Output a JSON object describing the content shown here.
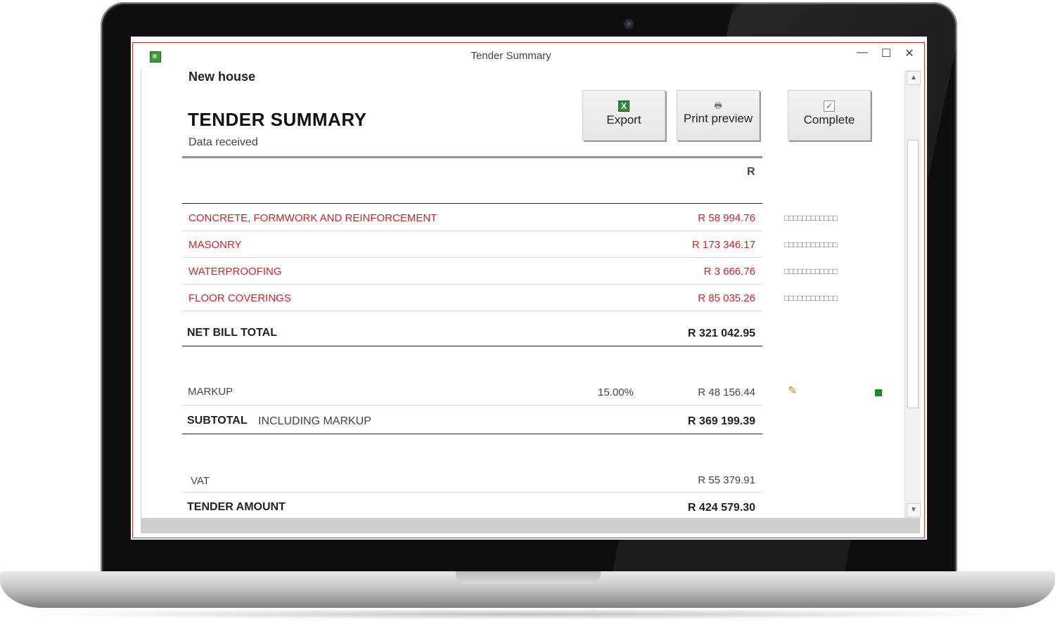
{
  "window": {
    "title": "Tender Summary",
    "minimize": "—",
    "maximize": "☐",
    "close": "✕"
  },
  "header": {
    "project": "New house",
    "heading": "TENDER SUMMARY",
    "status": "Data received"
  },
  "toolbar": {
    "export_label": "Export",
    "print_label": "Print preview",
    "complete_label": "Complete"
  },
  "table": {
    "currency_header": "R",
    "bills": [
      {
        "name": "CONCRETE, FORMWORK AND REINFORCEMENT",
        "amount": "R 58 994.76",
        "progress": "□□□□□□□□□□□□"
      },
      {
        "name": "MASONRY",
        "amount": "R 173 346.17",
        "progress": "□□□□□□□□□□□□"
      },
      {
        "name": "WATERPROOFING",
        "amount": "R 3 666.76",
        "progress": "□□□□□□□□□□□□"
      },
      {
        "name": "FLOOR COVERINGS",
        "amount": "R 85 035.26",
        "progress": "□□□□□□□□□□□□"
      }
    ],
    "net_total_label": "NET BILL TOTAL",
    "net_total": "R 321 042.95",
    "markup_label": "MARKUP",
    "markup_pct": "15.00%",
    "markup_amount": "R 48 156.44",
    "subtotal_label": "SUBTOTAL",
    "subtotal_note": "INCLUDING MARKUP",
    "subtotal": "R 369 199.39",
    "vat_label": "VAT",
    "vat_amount": "R 55 379.91",
    "tender_label": "TENDER AMOUNT",
    "tender_amount": "R 424 579.30"
  },
  "icons": {
    "pencil": "✎",
    "print": "🖶",
    "check": "✓",
    "xls": "X",
    "up": "▲",
    "down": "▼"
  },
  "colors": {
    "accent_red": "#c0282c",
    "status_green": "#1f8a2a"
  }
}
